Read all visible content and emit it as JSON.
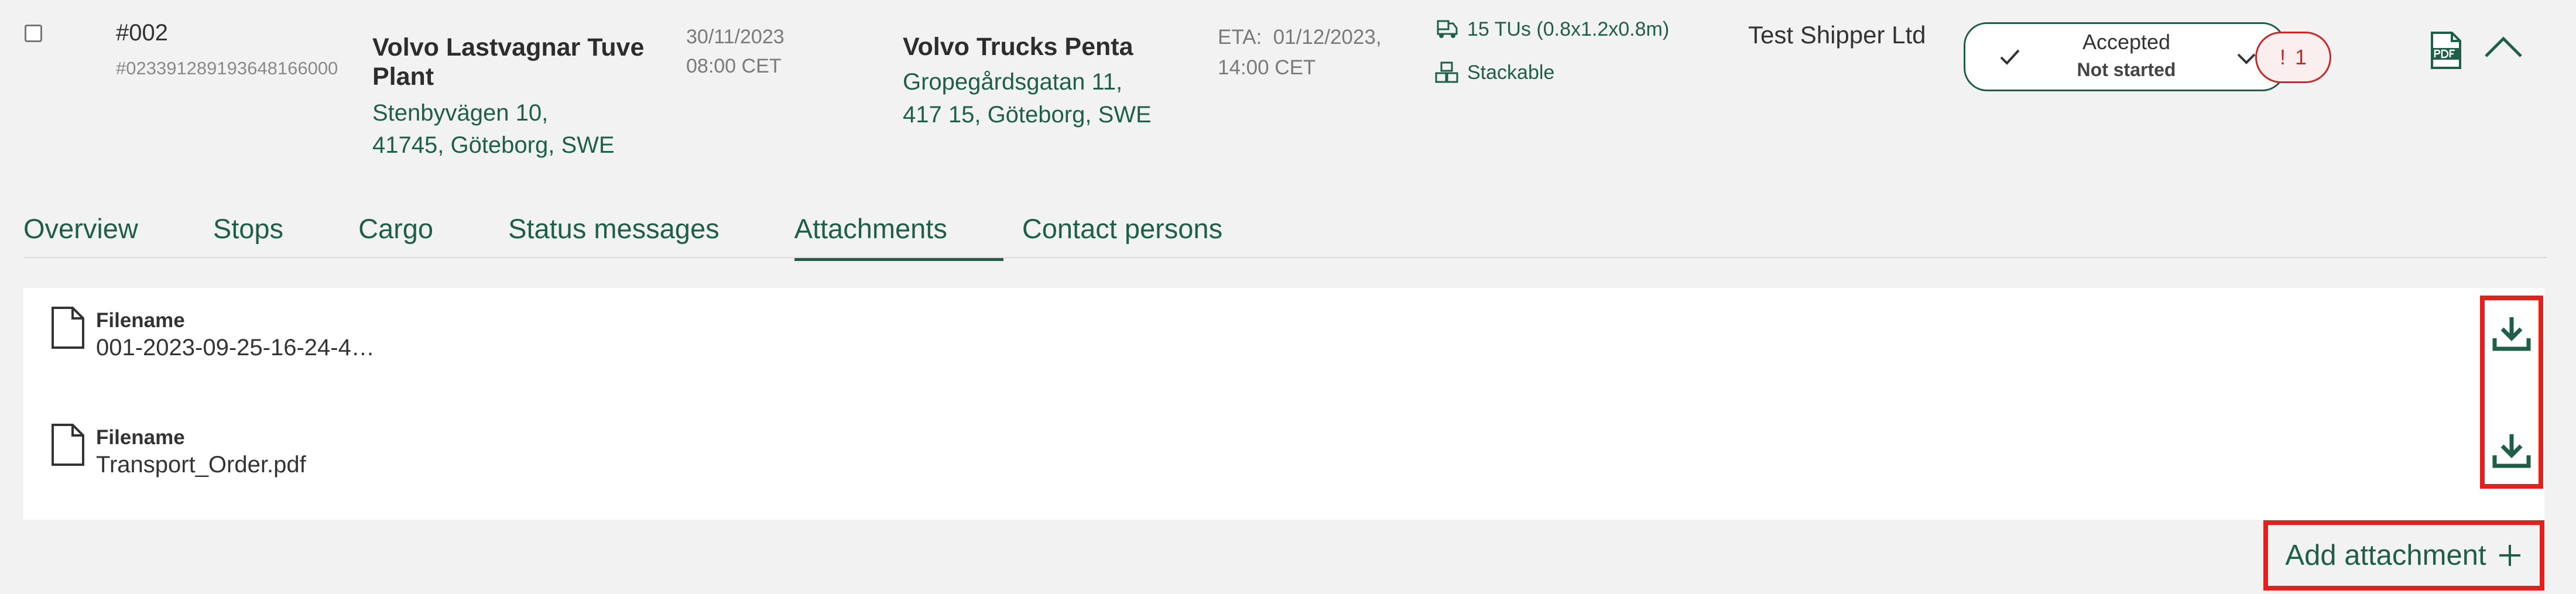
{
  "order": {
    "number": "#002",
    "id": "#023391289193648166000",
    "pickup": {
      "name": "Volvo Lastvagnar Tuve Plant",
      "address_line1": "Stenbyvägen 10,",
      "address_line2": "41745, Göteborg, SWE",
      "date": "30/11/2023",
      "time": "08:00 CET"
    },
    "delivery": {
      "name": "Volvo Trucks Penta",
      "address_line1": "Gropegårdsgatan 11,",
      "address_line2": "417 15, Göteborg, SWE",
      "eta_label": "ETA:",
      "eta_date": "01/12/2023,",
      "eta_time": "14:00 CET"
    },
    "cargo_summary": "15 TUs (0.8x1.2x0.8m)",
    "stackable": "Stackable",
    "shipper": "Test Shipper Ltd",
    "status": {
      "primary": "Accepted",
      "secondary": "Not started"
    },
    "alert": {
      "symbol": "!",
      "count": "1"
    }
  },
  "tabs": [
    {
      "label": "Overview"
    },
    {
      "label": "Stops"
    },
    {
      "label": "Cargo"
    },
    {
      "label": "Status messages"
    },
    {
      "label": "Attachments"
    },
    {
      "label": "Contact persons"
    }
  ],
  "active_tab": "Attachments",
  "attachments": [
    {
      "label": "Filename",
      "name": "001-2023-09-25-16-24-4…"
    },
    {
      "label": "Filename",
      "name": "Transport_Order.pdf"
    }
  ],
  "add_attachment": {
    "label": "Add attachment",
    "icon": "plus-icon"
  },
  "colors": {
    "accent": "#1f5f4a",
    "alert": "#c62828",
    "highlight": "#e2211c",
    "background": "#f2f2f2"
  }
}
